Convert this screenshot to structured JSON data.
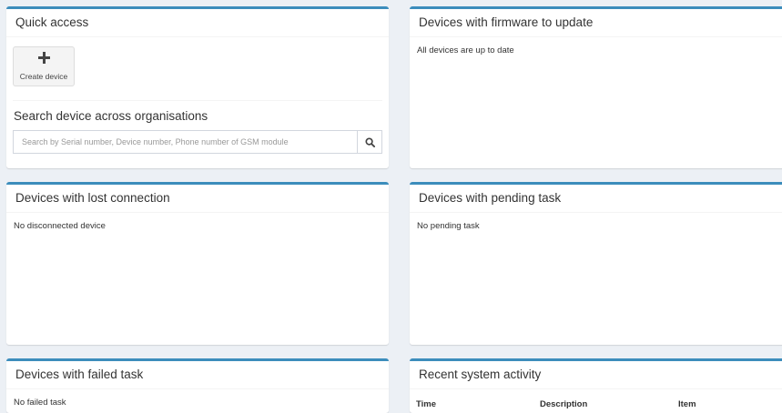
{
  "quick_access": {
    "title": "Quick access",
    "create_device_label": "Create device",
    "search_title": "Search device across organisations",
    "search_placeholder": "Search by Serial number, Device number, Phone number of GSM module"
  },
  "firmware": {
    "title": "Devices with firmware to update",
    "message": "All devices are up to date"
  },
  "lost_connection": {
    "title": "Devices with lost connection",
    "message": "No disconnected device"
  },
  "pending": {
    "title": "Devices with pending task",
    "message": "No pending task"
  },
  "failed": {
    "title": "Devices with failed task",
    "message": "No failed task"
  },
  "activity": {
    "title": "Recent system activity",
    "columns": [
      "Time",
      "Description",
      "Item"
    ]
  },
  "icons": {
    "create": "plus-icon",
    "search": "search-icon"
  },
  "colors": {
    "page_background": "#ecf0f5",
    "box_accent": "#3c8dbc",
    "button_background": "#f4f4f4"
  }
}
